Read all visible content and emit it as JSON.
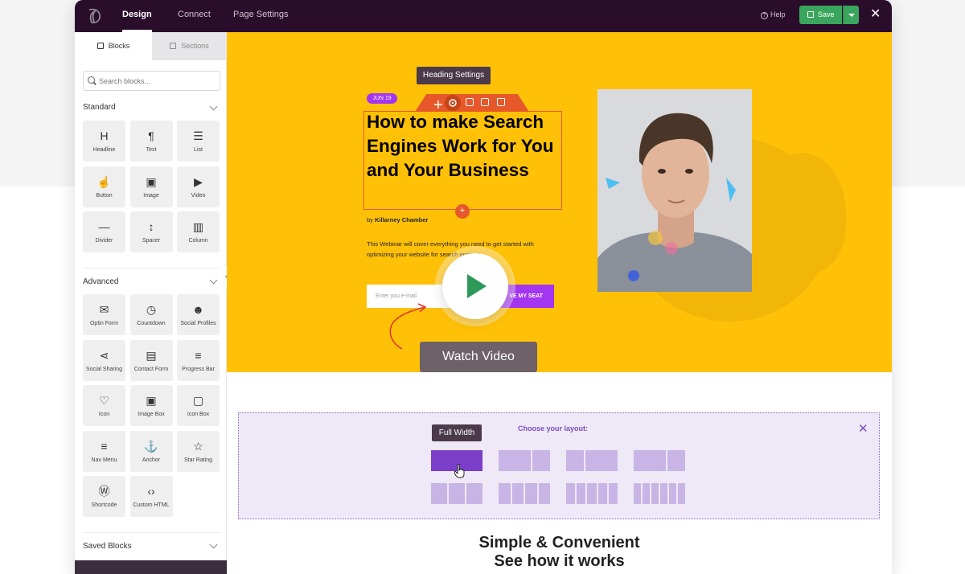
{
  "topbar": {
    "tabs": [
      "Design",
      "Connect",
      "Page Settings"
    ],
    "help_label": "Help",
    "save_label": "Save"
  },
  "sidebar": {
    "tabs": [
      "Blocks",
      "Sections"
    ],
    "search_placeholder": "Search blocks...",
    "groups": {
      "standard": "Standard",
      "advanced": "Advanced",
      "saved": "Saved Blocks"
    },
    "standard_blocks": [
      {
        "label": "Headline",
        "icon": "headline-icon"
      },
      {
        "label": "Text",
        "icon": "paragraph-icon"
      },
      {
        "label": "List",
        "icon": "list-icon"
      },
      {
        "label": "Button",
        "icon": "pointer-icon"
      },
      {
        "label": "Image",
        "icon": "image-icon"
      },
      {
        "label": "Video",
        "icon": "video-icon"
      },
      {
        "label": "Divider",
        "icon": "divider-icon"
      },
      {
        "label": "Spacer",
        "icon": "spacer-icon"
      },
      {
        "label": "Column",
        "icon": "column-icon"
      }
    ],
    "advanced_blocks": [
      {
        "label": "Optin Form",
        "icon": "mail-icon"
      },
      {
        "label": "Countdown",
        "icon": "stopwatch-icon"
      },
      {
        "label": "Social Profiles",
        "icon": "people-icon"
      },
      {
        "label": "Social Sharing",
        "icon": "share-icon"
      },
      {
        "label": "Contact Form",
        "icon": "form-icon"
      },
      {
        "label": "Progress Bar",
        "icon": "progress-icon"
      },
      {
        "label": "Icon",
        "icon": "heart-icon"
      },
      {
        "label": "Image Box",
        "icon": "image-box-icon"
      },
      {
        "label": "Icon Box",
        "icon": "icon-box-icon"
      },
      {
        "label": "Nav Menu",
        "icon": "menu-icon"
      },
      {
        "label": "Anchor",
        "icon": "anchor-icon"
      },
      {
        "label": "Star Rating",
        "icon": "star-icon"
      },
      {
        "label": "Shortcode",
        "icon": "wordpress-icon"
      },
      {
        "label": "Custom HTML",
        "icon": "code-icon"
      }
    ]
  },
  "hero": {
    "tooltip": "Heading Settings",
    "date_badge": "JUN 19",
    "headline": "How to make Search Engines Work for You and Your Business",
    "author_prefix": "by",
    "author": "Killarney Chamber",
    "description": "This Webinar will cover everything you need to get started with optimizing your website for search engines.",
    "email_placeholder": "Enter you e-mail",
    "seat_button": "VE MY SEAT",
    "watch_video": "Watch Video"
  },
  "layout_picker": {
    "title": "Choose your layout:",
    "tooltip": "Full Width"
  },
  "section": {
    "line1": "Simple & Convenient",
    "line2": "See how it works"
  },
  "colors": {
    "topbar": "#2a0d2b",
    "hero_bg": "#ffc107",
    "accent_orange": "#e6582a",
    "accent_purple": "#a435f0",
    "save_green": "#3aa55d"
  }
}
